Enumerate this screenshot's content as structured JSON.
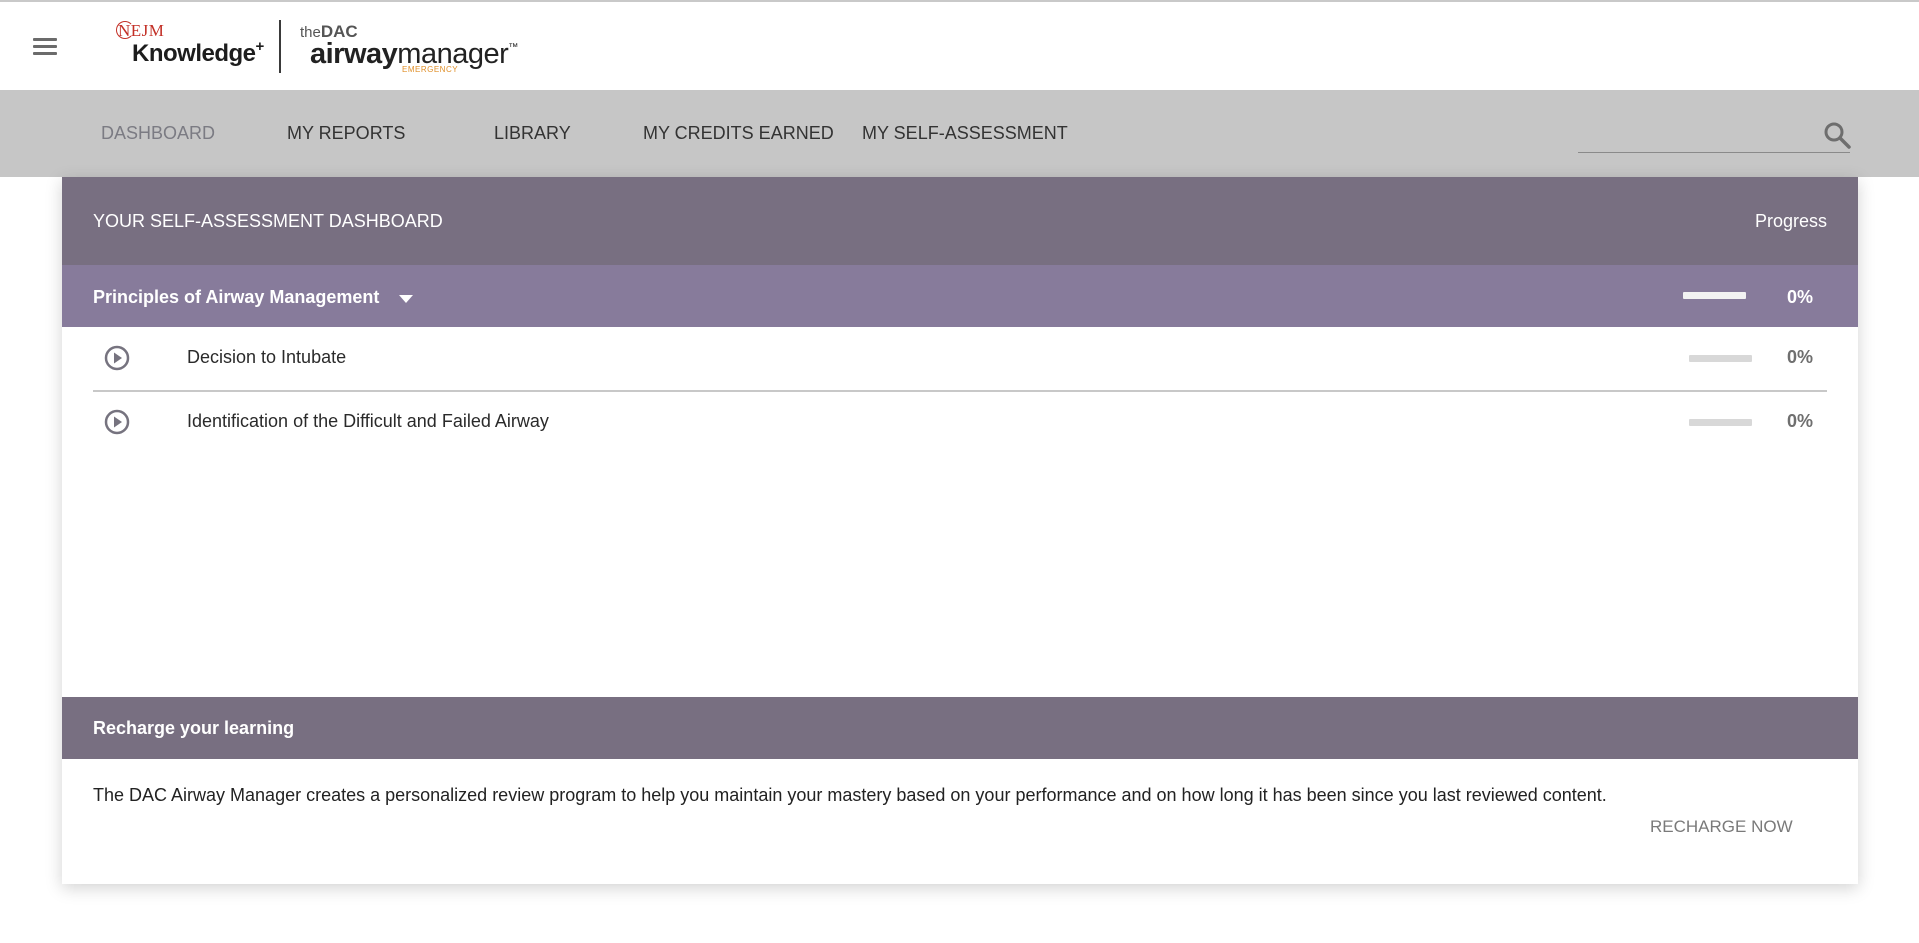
{
  "brand": {
    "nejm_small": "NEJM",
    "knowledge": "Knowledge",
    "knowledge_plus": "+",
    "dac_the": "the",
    "dac_dac": "DAC",
    "dac_airway": "airway",
    "dac_manager": "manager",
    "dac_tm": "™",
    "dac_emergency": "EMERGENCY"
  },
  "nav": {
    "items": [
      {
        "label": "DASHBOARD",
        "active": true
      },
      {
        "label": "MY REPORTS",
        "active": false
      },
      {
        "label": "LIBRARY",
        "active": false
      },
      {
        "label": "MY CREDITS EARNED",
        "active": false
      },
      {
        "label": "MY SELF-ASSESSMENT",
        "active": false
      }
    ],
    "search_placeholder": ""
  },
  "dashboard": {
    "title": "YOUR SELF-ASSESSMENT DASHBOARD",
    "progress_label": "Progress",
    "section": {
      "title": "Principles of Airway Management",
      "progress": 0,
      "progress_text": "0%",
      "topics": [
        {
          "label": "Decision to Intubate",
          "progress": 0,
          "progress_text": "0%"
        },
        {
          "label": "Identification of the Difficult and Failed Airway",
          "progress": 0,
          "progress_text": "0%"
        }
      ]
    }
  },
  "recharge": {
    "title": "Recharge your learning",
    "text": "The DAC Airway Manager creates a personalized review program to help you maintain your mastery based on your performance and on how long it has been since you last reviewed content.",
    "button": "RECHARGE NOW"
  },
  "colors": {
    "header_purple": "#786f81",
    "section_purple": "#877b9b",
    "nav_gray": "#c6c6c6",
    "nejm_red": "#c33027",
    "emergency_orange": "#e0902a"
  }
}
